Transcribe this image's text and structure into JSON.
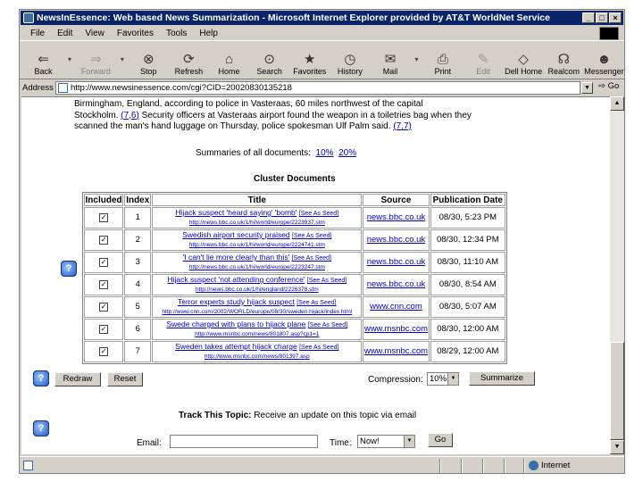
{
  "window": {
    "title": "NewsInEssence: Web based News Summarization - Microsoft Internet Explorer provided by AT&T WorldNet Service",
    "min": "_",
    "max": "□",
    "close": "×"
  },
  "menu": [
    "File",
    "Edit",
    "View",
    "Favorites",
    "Tools",
    "Help"
  ],
  "toolbar": [
    {
      "label": "Back",
      "icon": "back-arrow-icon",
      "glyph": "⇐",
      "disabled": false
    },
    {
      "label": "Forward",
      "icon": "forward-arrow-icon",
      "glyph": "⇒",
      "disabled": true
    },
    {
      "label": "Stop",
      "icon": "stop-icon",
      "glyph": "⊗",
      "disabled": false
    },
    {
      "label": "Refresh",
      "icon": "refresh-icon",
      "glyph": "⟳",
      "disabled": false
    },
    {
      "label": "Home",
      "icon": "home-icon",
      "glyph": "⌂",
      "disabled": false
    },
    {
      "label": "Search",
      "icon": "search-icon",
      "glyph": "⊙",
      "disabled": false
    },
    {
      "label": "Favorites",
      "icon": "favorites-icon",
      "glyph": "★",
      "disabled": false
    },
    {
      "label": "History",
      "icon": "history-icon",
      "glyph": "◷",
      "disabled": false
    },
    {
      "label": "Mail",
      "icon": "mail-icon",
      "glyph": "✉",
      "disabled": false
    },
    {
      "label": "Print",
      "icon": "print-icon",
      "glyph": "⎙",
      "disabled": false
    },
    {
      "label": "Edit",
      "icon": "edit-icon",
      "glyph": "✎",
      "disabled": true
    },
    {
      "label": "Dell Home",
      "icon": "dell-home-icon",
      "glyph": "◇",
      "disabled": false
    },
    {
      "label": "Realcom",
      "icon": "realcom-icon",
      "glyph": "☊",
      "disabled": false
    },
    {
      "label": "Messenger",
      "icon": "messenger-icon",
      "glyph": "☻",
      "disabled": false
    }
  ],
  "address": {
    "label": "Address",
    "url": "http://www.newsinessence.com/cgi?CID=20020830135218",
    "go": "Go"
  },
  "article": {
    "line1": "Birmingham, England, according to police in Vasteraas, 60 miles northwest of the capital",
    "line2_a": "Stockholm.",
    "line2_link": "(7,6)",
    "line2_b": "Security officers at Vasteraas airport found the weapon in a toiletries bag when they",
    "line3_a": "scanned the man's hand luggage on Thursday, police spokesman Ulf Palm said.",
    "line3_link": "(7,7)"
  },
  "summaries": {
    "label": "Summaries of all documents:",
    "opt1": "10%",
    "opt2": "20%"
  },
  "cluster": {
    "heading": "Cluster Documents",
    "columns": [
      "Included",
      "Index",
      "Title",
      "Source",
      "Publication Date"
    ],
    "rows": [
      {
        "checked": "✓",
        "index": "1",
        "title": "Hijack suspect 'heard saying' 'bomb'",
        "see": "[See As Seed]",
        "url": "http://news.bbc.co.uk/1/hi/world/europe/2223937.stm",
        "source": "news.bbc.co.uk",
        "date": "08/30, 5:23 PM"
      },
      {
        "checked": "✓",
        "index": "2",
        "title": "Swedish airport security praised",
        "see": "[See As Seed]",
        "url": "http://news.bbc.co.uk/1/hi/world/europe/2224741.stm",
        "source": "news.bbc.co.uk",
        "date": "08/30, 12:34 PM"
      },
      {
        "checked": "✓",
        "index": "3",
        "title": "'I can't lie more clearly than this'",
        "see": "[See As Seed]",
        "url": "http://news.bbc.co.uk/1/hi/world/europe/2223247.stm",
        "source": "news.bbc.co.uk",
        "date": "08/30, 11:10 AM"
      },
      {
        "checked": "✓",
        "index": "4",
        "title": "Hijack suspect 'not attending conference'",
        "see": "[See As Seed]",
        "url": "http://news.bbc.co.uk/1/hi/england/2226378.stm",
        "source": "news.bbc.co.uk",
        "date": "08/30, 8:54 AM"
      },
      {
        "checked": "✓",
        "index": "5",
        "title": "Terror experts study hijack suspect",
        "see": "[See As Seed]",
        "url": "http://www.cnn.com/2002/WORLD/europe/08/30/sweden.hijack/index.html",
        "source": "www.cnn.com",
        "date": "08/30, 5:07 AM"
      },
      {
        "checked": "✓",
        "index": "6",
        "title": "Swede charged with plans to hijack plane",
        "see": "[See As Seed]",
        "url": "http://www.msnbc.com/news/801807.asp?cp1=1",
        "source": "www.msnbc.com",
        "date": "08/30, 12:00 AM"
      },
      {
        "checked": "✓",
        "index": "7",
        "title": "Sweden takes attempt hijack charge",
        "see": "[See As Seed]",
        "url": "http://www.msnbc.com/news/801397.asp",
        "source": "www.msnbc.com",
        "date": "08/29, 12:00 AM"
      }
    ]
  },
  "controls": {
    "redraw": "Redraw",
    "reset": "Reset",
    "compression_label": "Compression:",
    "compression_value": "10%",
    "summarize": "Summarize"
  },
  "track": {
    "heading": "Track This Topic:",
    "desc": "Receive an update on this topic via email",
    "email_label": "Email:",
    "email_value": "",
    "time_label": "Time:",
    "time_value": "Now!",
    "go": "Go"
  },
  "help_glyph": "?",
  "status": {
    "zone": "Internet"
  }
}
